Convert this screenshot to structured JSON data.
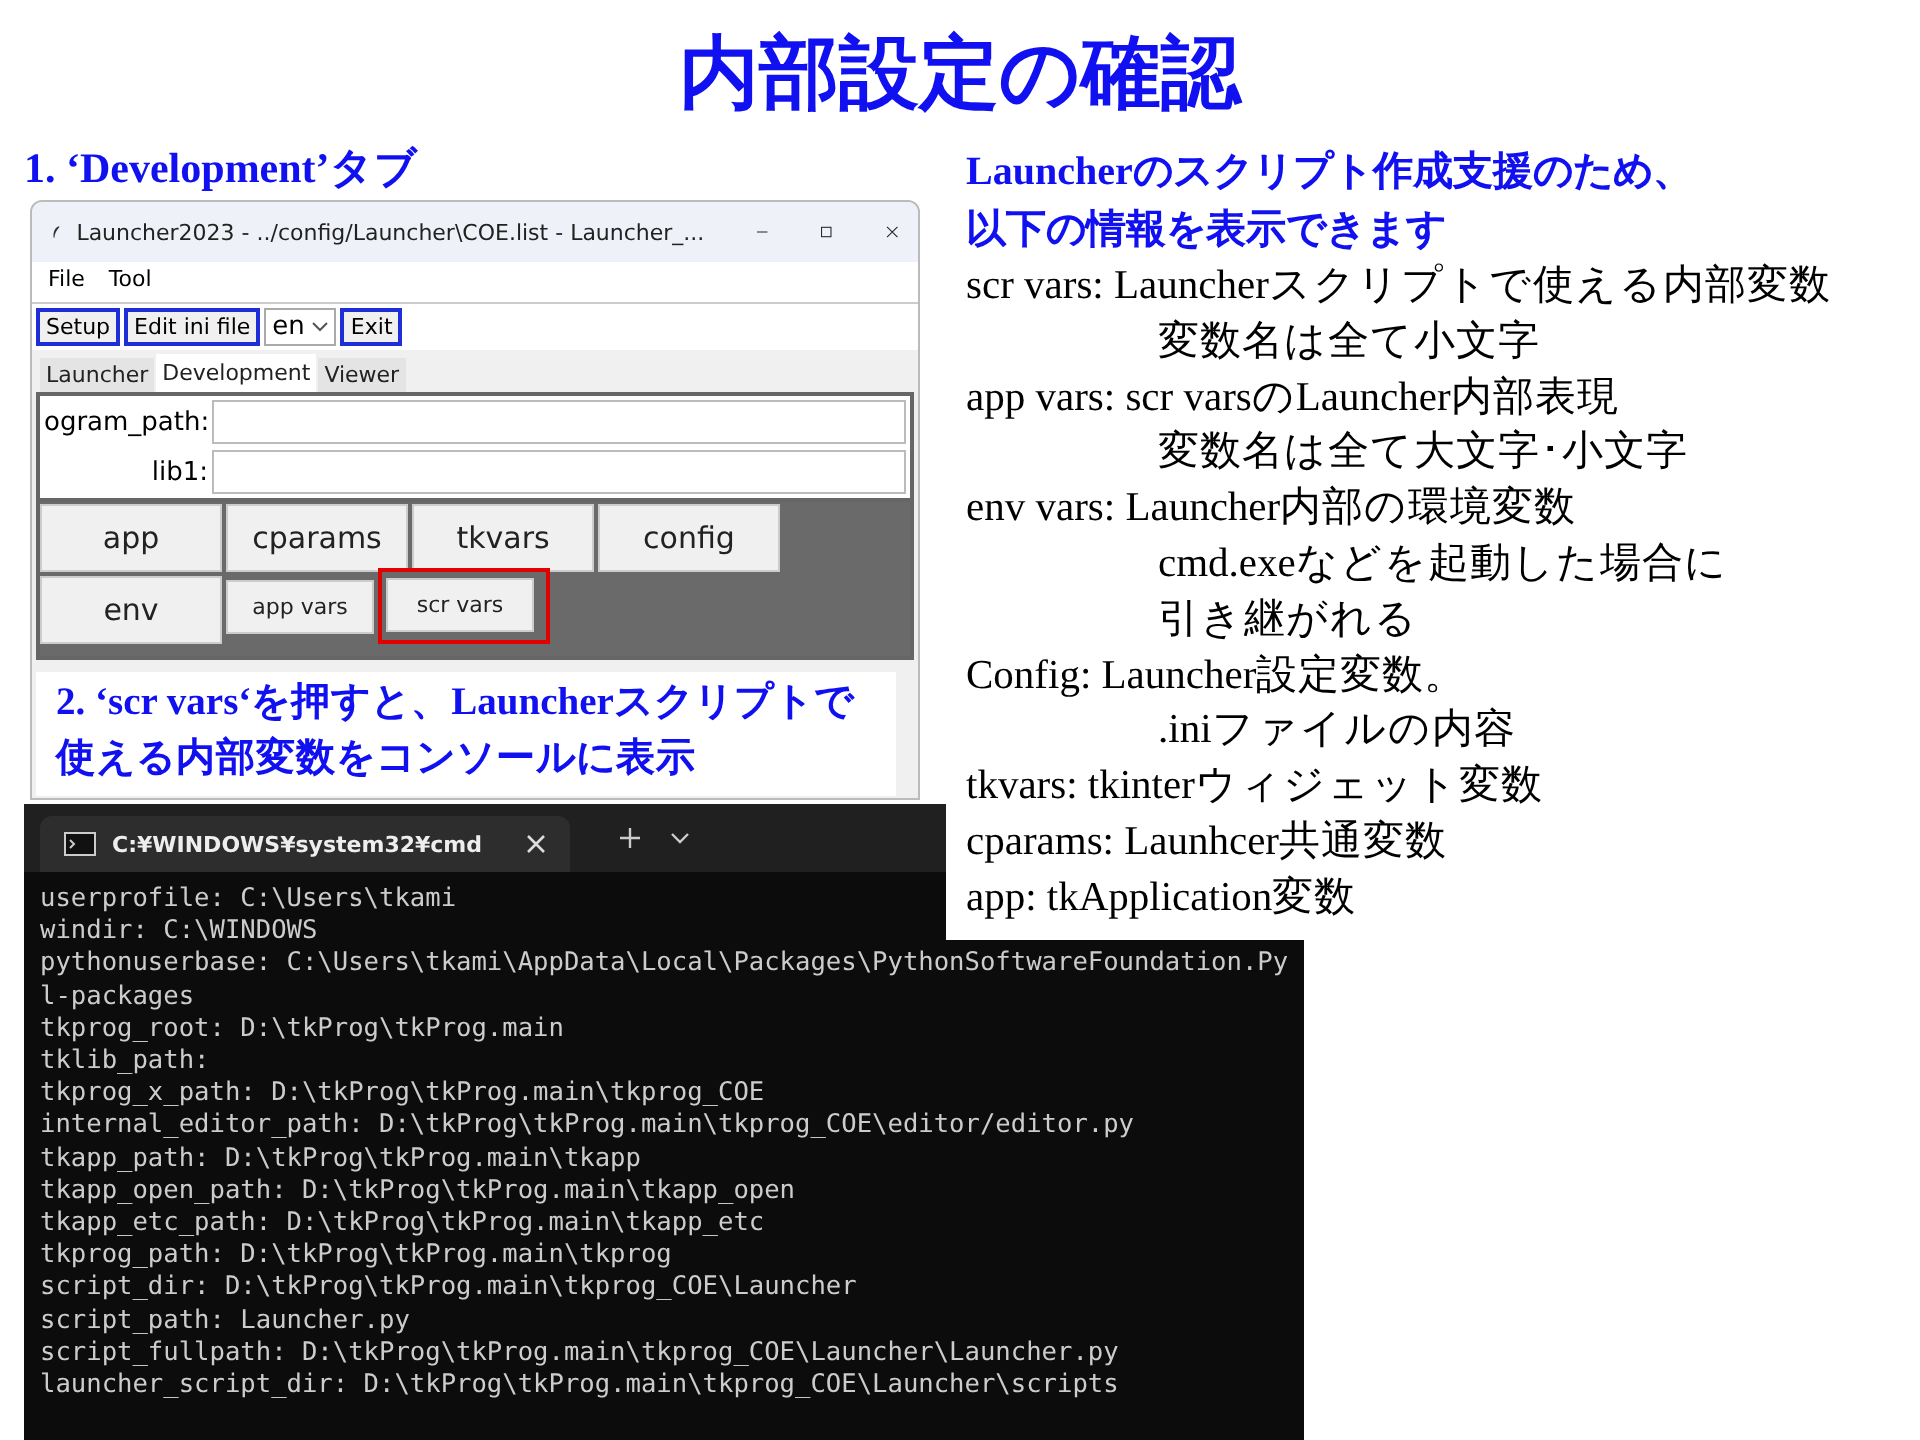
{
  "title": "内部設定の確認",
  "step1_heading": "1. ‘Development’タブ",
  "app_window": {
    "title": "Launcher2023 - ../config/Launcher\\COE.list - Launcher_...",
    "menu": [
      "File",
      "Tool"
    ],
    "toolbar": [
      {
        "kind": "button",
        "label": "Setup"
      },
      {
        "kind": "button",
        "label": "Edit ini file"
      },
      {
        "kind": "dropdown",
        "label": "en"
      },
      {
        "kind": "button",
        "label": "Exit"
      }
    ],
    "tabs": [
      {
        "label": "Launcher",
        "selected": false
      },
      {
        "label": "Development",
        "selected": true
      },
      {
        "label": "Viewer",
        "selected": false
      }
    ],
    "fields": [
      {
        "label": "ogram_path:"
      },
      {
        "label": "lib1:"
      }
    ],
    "button_rows": [
      [
        {
          "label": "app",
          "kind": "large",
          "highlighted": false
        },
        {
          "label": "cparams",
          "kind": "large",
          "highlighted": false
        },
        {
          "label": "tkvars",
          "kind": "large",
          "highlighted": false
        },
        {
          "label": "config",
          "kind": "large",
          "highlighted": false
        }
      ],
      [
        {
          "label": "env",
          "kind": "large",
          "highlighted": false
        },
        {
          "label": "app vars",
          "kind": "small",
          "highlighted": false
        },
        {
          "label": "scr vars",
          "kind": "small",
          "highlighted": true
        }
      ]
    ]
  },
  "step2_callout": "2. ‘scr vars‘を押すと、Launcherスクリプトで使える内部変数をコンソールに表示",
  "terminal": {
    "tab_title": "C:¥WINDOWS¥system32¥cmd",
    "lines": [
      "userprofile: C:\\Users\\tkami",
      "windir: C:\\WINDOWS",
      "pythonuserbase: C:\\Users\\tkami\\AppData\\Local\\Packages\\PythonSoftwareFoundation.Py",
      "l-packages",
      "tkprog_root: D:\\tkProg\\tkProg.main",
      "tklib_path:",
      "tkprog_x_path: D:\\tkProg\\tkProg.main\\tkprog_COE",
      "internal_editor_path: D:\\tkProg\\tkProg.main\\tkprog_COE\\editor/editor.py",
      "tkapp_path: D:\\tkProg\\tkProg.main\\tkapp",
      "tkapp_open_path: D:\\tkProg\\tkProg.main\\tkapp_open",
      "tkapp_etc_path: D:\\tkProg\\tkProg.main\\tkapp_etc",
      "tkprog_path: D:\\tkProg\\tkProg.main\\tkprog",
      "script_dir: D:\\tkProg\\tkProg.main\\tkprog_COE\\Launcher",
      "script_path: Launcher.py",
      "script_fullpath: D:\\tkProg\\tkProg.main\\tkprog_COE\\Launcher\\Launcher.py",
      "launcher_script_dir: D:\\tkProg\\tkProg.main\\tkprog_COE\\Launcher\\scripts"
    ]
  },
  "description": {
    "heading": [
      "Launcherのスクリプト作成支援のため、",
      "以下の情報を表示できます"
    ],
    "lines": [
      {
        "kind": "term",
        "text": "scr vars: Launcherスクリプトで使える内部変数"
      },
      {
        "kind": "continuation",
        "text": "変数名は全て小文字"
      },
      {
        "kind": "term",
        "text": "app vars: scr varsのLauncher内部表現"
      },
      {
        "kind": "continuation",
        "text": "変数名は全て大文字･小文字"
      },
      {
        "kind": "term",
        "text": "env vars: Launcher内部の環境変数"
      },
      {
        "kind": "continuation",
        "text": "cmd.exeなどを起動した場合に"
      },
      {
        "kind": "continuation",
        "text": "引き継がれる"
      },
      {
        "kind": "term",
        "text": "Config: Launcher設定変数。"
      },
      {
        "kind": "continuation",
        "text": ".iniファイルの内容"
      },
      {
        "kind": "term",
        "text": "tkvars: tkinterウィジェット変数"
      },
      {
        "kind": "term",
        "text": "cparams: Launhcer共通変数"
      },
      {
        "kind": "term",
        "text": "app: tkApplication変数"
      }
    ]
  }
}
